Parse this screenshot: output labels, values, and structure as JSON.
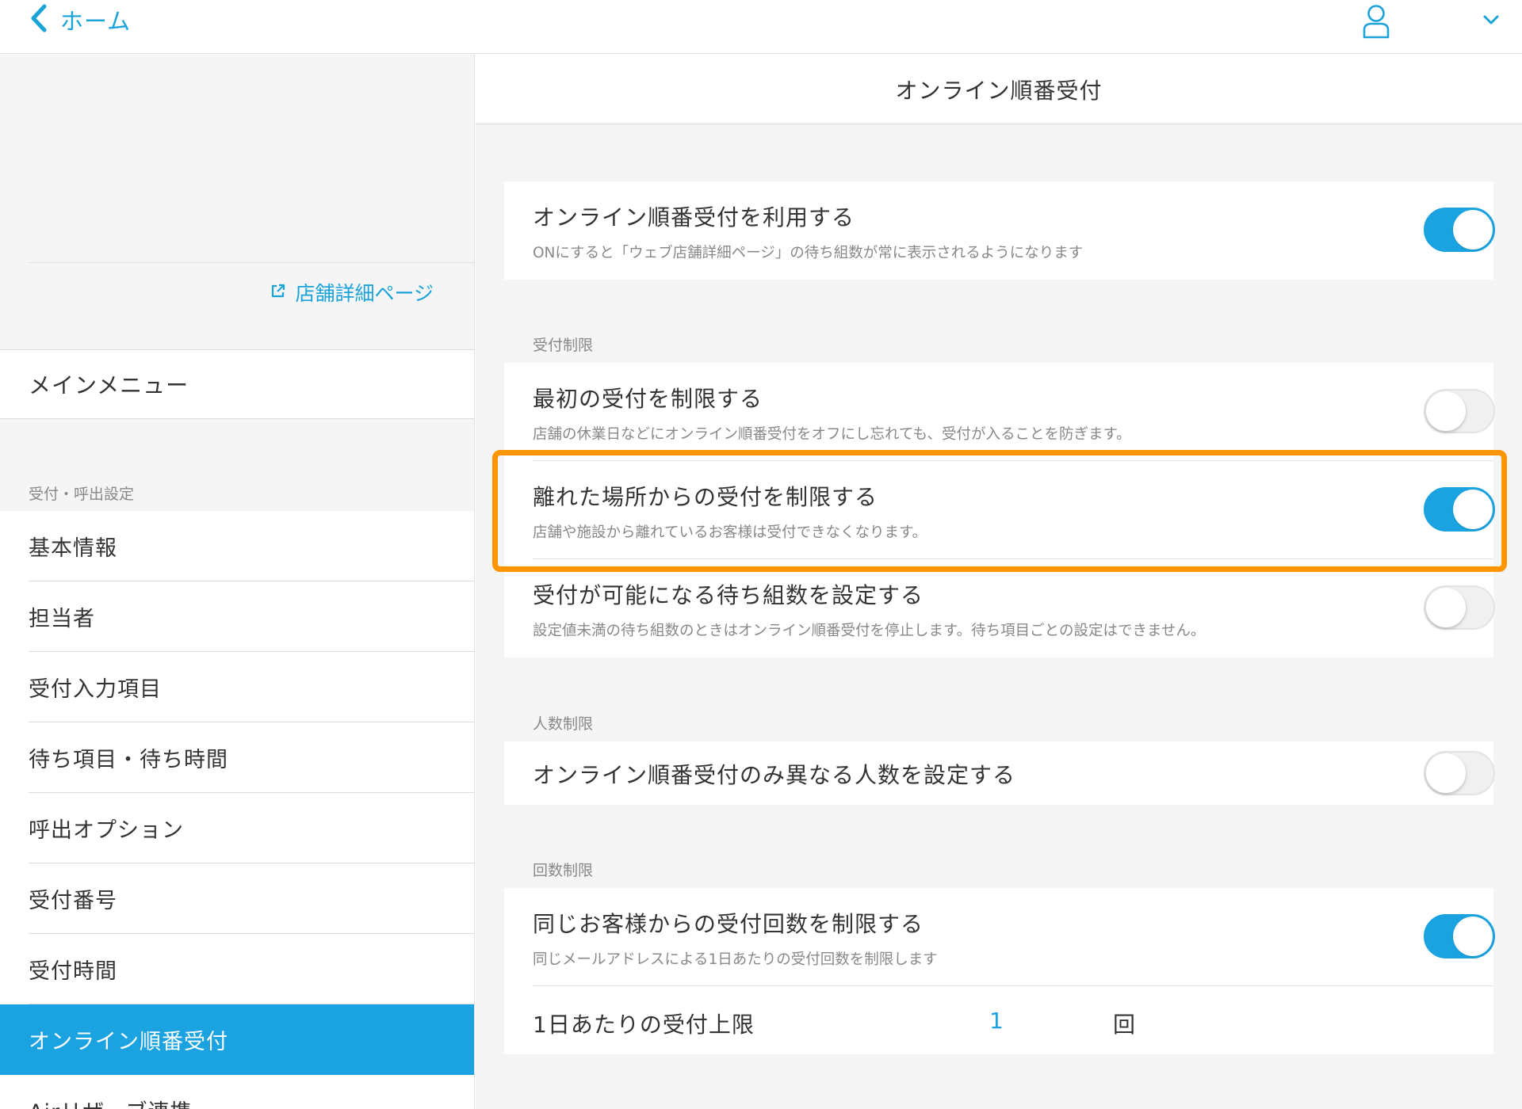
{
  "topbar": {
    "back_label": "ホーム",
    "back_icon": "chevron-left-icon",
    "user_icon": "user-icon",
    "menu_icon": "chevron-down-icon",
    "accent_color": "#1aa3e0"
  },
  "sidebar": {
    "store_link_label": "店舗詳細ページ",
    "store_link_icon": "external-link-icon",
    "main_menu_label": "メインメニュー",
    "section_caption": "受付・呼出設定",
    "items": [
      {
        "label": "基本情報",
        "active": false
      },
      {
        "label": "担当者",
        "active": false
      },
      {
        "label": "受付入力項目",
        "active": false
      },
      {
        "label": "待ち項目・待ち時間",
        "active": false
      },
      {
        "label": "呼出オプション",
        "active": false
      },
      {
        "label": "受付番号",
        "active": false
      },
      {
        "label": "受付時間",
        "active": false
      },
      {
        "label": "オンライン順番受付",
        "active": true
      },
      {
        "label": "Airリザーブ連携",
        "active": false
      }
    ]
  },
  "main": {
    "title": "オンライン順番受付",
    "use_online": {
      "title": "オンライン順番受付を利用する",
      "desc": "ONにすると「ウェブ店舗詳細ページ」の待ち組数が常に表示されるようになります",
      "on": true
    },
    "reception_limit": {
      "caption": "受付制限",
      "first_limit": {
        "title": "最初の受付を制限する",
        "desc": "店舗の休業日などにオンライン順番受付をオフにし忘れても、受付が入ることを防ぎます。",
        "on": false
      },
      "remote_limit": {
        "title": "離れた場所からの受付を制限する",
        "desc": "店舗や施設から離れているお客様は受付できなくなります。",
        "on": true
      },
      "wait_count": {
        "title": "受付が可能になる待ち組数を設定する",
        "desc": "設定値未満の待ち組数のときはオンライン順番受付を停止します。待ち項目ごとの設定はできません。",
        "on": false
      }
    },
    "people_limit": {
      "caption": "人数制限",
      "different_count": {
        "title": "オンライン順番受付のみ異なる人数を設定する",
        "on": false
      }
    },
    "count_limit": {
      "caption": "回数制限",
      "same_customer": {
        "title": "同じお客様からの受付回数を制限する",
        "desc": "同じメールアドレスによる1日あたりの受付回数を制限します",
        "on": true
      },
      "daily_limit": {
        "label": "1日あたりの受付上限",
        "value": "1",
        "unit": "回"
      }
    },
    "highlight_color": "#ff9500"
  }
}
